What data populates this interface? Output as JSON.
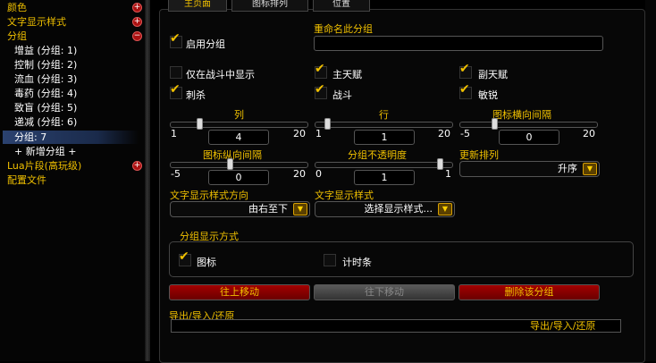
{
  "sidebar": {
    "items": [
      {
        "label": "颜色",
        "expander": "+"
      },
      {
        "label": "文字显示样式",
        "expander": "+"
      },
      {
        "label": "分组",
        "expander": "−"
      },
      {
        "label": "增益 (分组: 1)"
      },
      {
        "label": "控制 (分组: 2)"
      },
      {
        "label": "流血 (分组: 3)"
      },
      {
        "label": "毒药 (分组: 4)"
      },
      {
        "label": "致盲 (分组: 5)"
      },
      {
        "label": "递减 (分组: 6)"
      },
      {
        "label": "分组: 7"
      },
      {
        "label": "+ 新增分组 +"
      },
      {
        "label": "Lua片段(高玩级)",
        "expander": "+"
      },
      {
        "label": "配置文件"
      }
    ]
  },
  "tabs": [
    "主页面",
    "图标排列",
    "位置"
  ],
  "main": {
    "enable_group": "启用分组",
    "rename_label": "重命名此分组",
    "rename_value": "",
    "only_in_combat": "仅在战斗中显示",
    "primary_spec": "主天赋",
    "secondary_spec": "副天赋",
    "stealth": "刺杀",
    "combat": "战斗",
    "subtlety": "敏锐",
    "columns": {
      "label": "列",
      "min": "1",
      "max": "20",
      "value": "4"
    },
    "rows": {
      "label": "行",
      "min": "1",
      "max": "20",
      "value": "1"
    },
    "icon_h_spacing": {
      "label": "图标横向间隔",
      "min": "-5",
      "max": "20",
      "value": "0"
    },
    "icon_v_spacing": {
      "label": "图标纵向间隔",
      "min": "-5",
      "max": "20",
      "value": "0"
    },
    "group_opacity": {
      "label": "分组不透明度",
      "min": "0",
      "max": "1",
      "value": "1"
    },
    "sort_label": "更新排列",
    "sort_value": "升序",
    "text_dir_label": "文字显示样式方向",
    "text_dir_value": "由右至下",
    "text_style_label": "文字显示样式",
    "text_style_value": "选择显示样式...",
    "display_mode_label": "分组显示方式",
    "icon_mode": "图标",
    "timer_mode": "计时条",
    "move_up": "往上移动",
    "move_down": "往下移动",
    "delete_group": "删除该分组",
    "export_label": "导出/导入/还原",
    "export_button": "导出/导入/还原"
  },
  "colors": {
    "gold": "#f0c000",
    "selected": "#2b4270",
    "button_red": "#a30000"
  }
}
